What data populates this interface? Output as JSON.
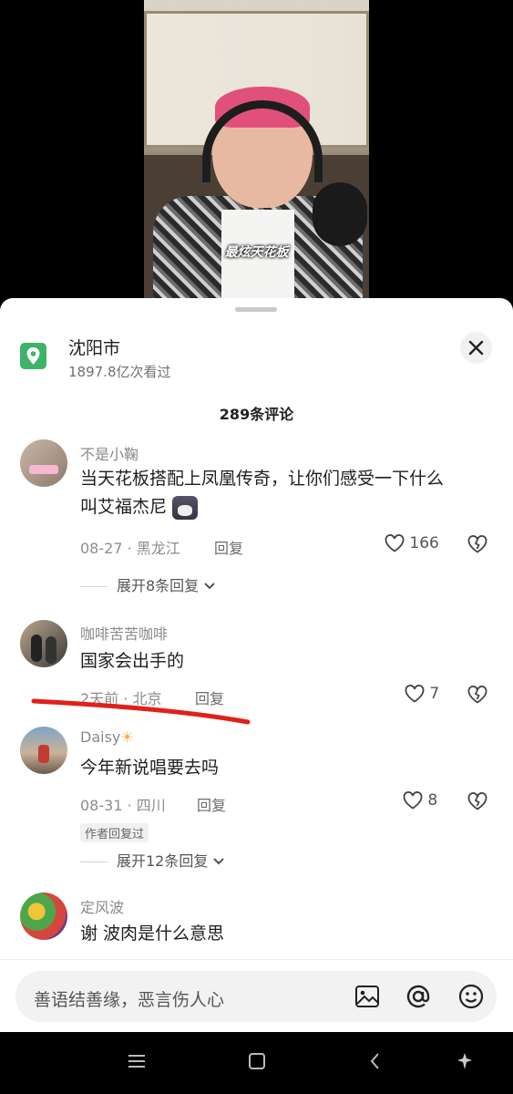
{
  "video": {
    "caption": "最炫天花板"
  },
  "location": {
    "name": "沈阳市",
    "views": "1897.8亿次看过",
    "icon": "location-pin-icon"
  },
  "comments_title": "289条评论",
  "comments": [
    {
      "user": "不是小鞠",
      "text_line1": "当天花板搭配上凤凰传奇，让你们感受一下什么",
      "text_line2": "叫艾福杰尼",
      "meta": "08-27 · 黑龙江",
      "reply_label": "回复",
      "likes": "166",
      "expand": "展开8条回复"
    },
    {
      "user": "咖啡苦苦咖啡",
      "text_line1": "国家会出手的",
      "meta": "2天前 · 北京",
      "reply_label": "回复",
      "likes": "7"
    },
    {
      "user": "Daisy",
      "text_line1": "今年新说唱要去吗",
      "meta": "08-31 · 四川",
      "reply_label": "回复",
      "likes": "8",
      "badge": "作者回复过",
      "expand": "展开12条回复"
    },
    {
      "user": "定风波",
      "text_line1": "谢 波肉是什么意思"
    }
  ],
  "input": {
    "placeholder": "善语结善缘，恶言伤人心"
  },
  "colors": {
    "location_green": "#3db368",
    "annotation_red": "#e0201b"
  }
}
